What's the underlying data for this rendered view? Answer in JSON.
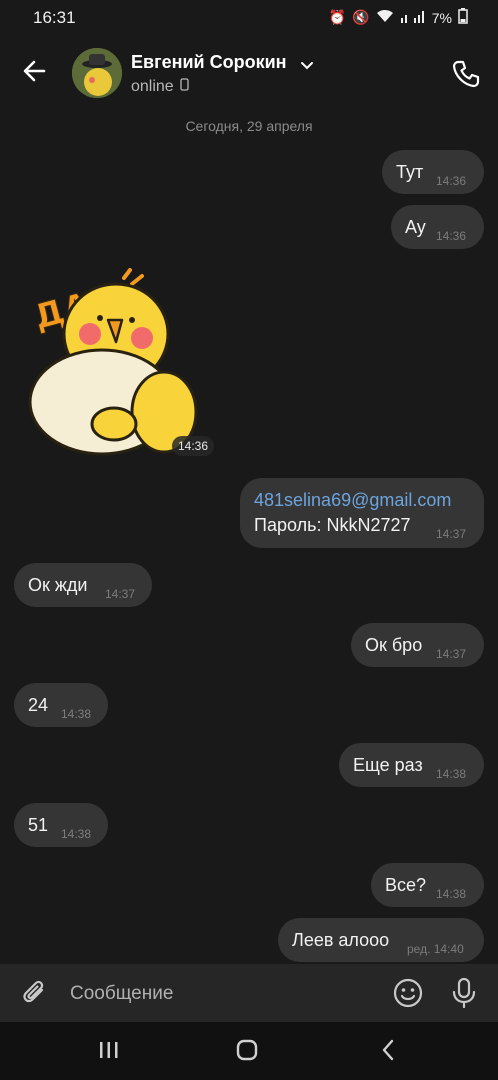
{
  "status_bar": {
    "time": "16:31",
    "battery": "7%"
  },
  "header": {
    "contact_name": "Евгений Сорокин",
    "status": "online"
  },
  "date_separator": "Сегодня, 29 апреля",
  "messages": [
    {
      "side": "out",
      "text": "Тут",
      "time": "14:36"
    },
    {
      "side": "out",
      "text": "Ау",
      "time": "14:36"
    },
    {
      "side": "in",
      "type": "sticker",
      "sticker_text": "ДА!",
      "time": "14:36"
    },
    {
      "side": "out",
      "line1": "481selina69@gmail.com",
      "line2": "Пароль: NkkN2727",
      "time": "14:37"
    },
    {
      "side": "in",
      "text": "Ок жди",
      "time": "14:37"
    },
    {
      "side": "out",
      "text": "Ок бро",
      "time": "14:37"
    },
    {
      "side": "in",
      "text": "24",
      "time": "14:38"
    },
    {
      "side": "out",
      "text": "Еще раз",
      "time": "14:38"
    },
    {
      "side": "in",
      "text": "51",
      "time": "14:38"
    },
    {
      "side": "out",
      "text": "Все?",
      "time": "14:38"
    },
    {
      "side": "out",
      "text": "Леев алооо",
      "time": "ред. 14:40"
    }
  ],
  "input": {
    "placeholder": "Сообщение"
  },
  "icons": [
    "back-arrow-icon",
    "chevron-down-icon",
    "phone-icon",
    "mobile-icon",
    "paperclip-icon",
    "emoji-icon",
    "microphone-icon",
    "recents-icon",
    "home-icon",
    "nav-back-icon"
  ],
  "colors": {
    "background": "#191919",
    "bubble": "#353535",
    "link": "#6da4dc"
  }
}
